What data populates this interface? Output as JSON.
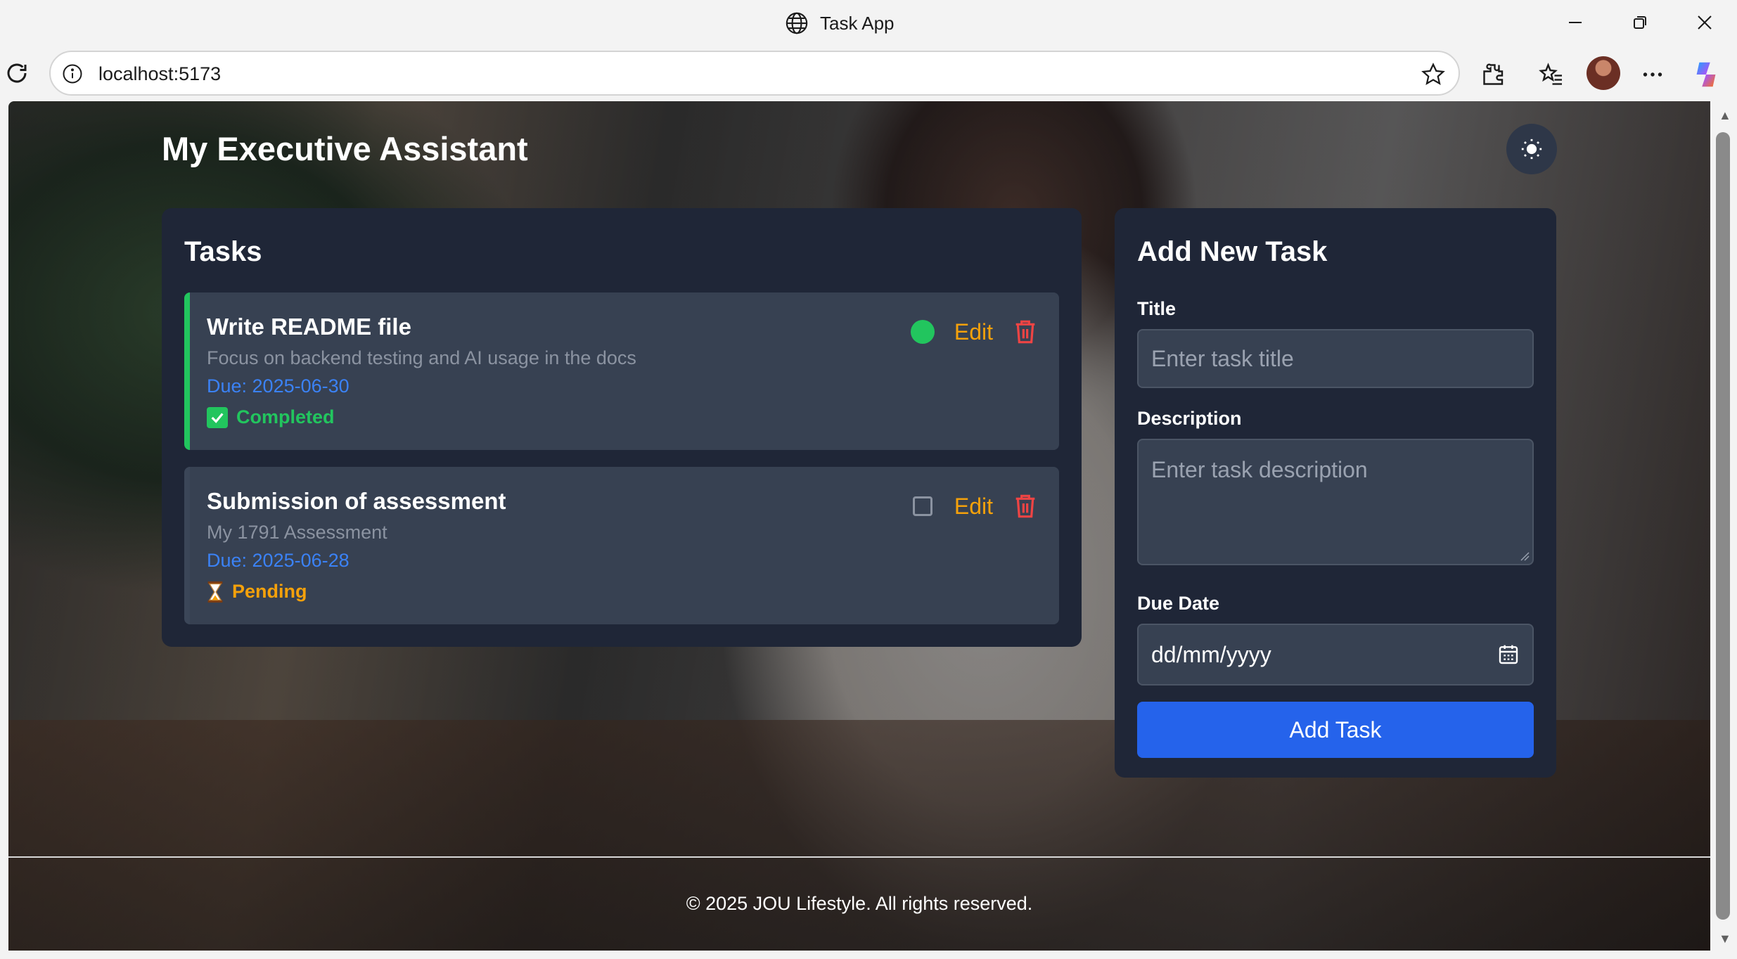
{
  "window": {
    "title": "Task App"
  },
  "browser": {
    "url": "localhost:5173"
  },
  "app": {
    "title": "My Executive Assistant"
  },
  "tasks_panel": {
    "heading": "Tasks",
    "tasks": [
      {
        "title": "Write README file",
        "description": "Focus on backend testing and AI usage in the docs",
        "due": "Due: 2025-06-30",
        "status": "Completed",
        "edit_label": "Edit",
        "completed": true
      },
      {
        "title": "Submission of assessment",
        "description": "My 1791 Assessment",
        "due": "Due: 2025-06-28",
        "status": "Pending",
        "edit_label": "Edit",
        "completed": false
      }
    ]
  },
  "add_panel": {
    "heading": "Add New Task",
    "title_label": "Title",
    "title_placeholder": "Enter task title",
    "description_label": "Description",
    "description_placeholder": "Enter task description",
    "due_label": "Due Date",
    "due_placeholder": "dd/mm/yyyy",
    "submit_label": "Add Task"
  },
  "footer": {
    "text": "© 2025 JOU Lifestyle. All rights reserved."
  },
  "icons": {
    "status_pending": "hourglass-icon",
    "status_completed": "check-box-icon",
    "theme": "sun-icon"
  },
  "colors": {
    "accent": "#2563eb",
    "completed": "#22c55e",
    "pending": "#f5a10b",
    "danger": "#ef4444",
    "panel": "#1f2637"
  }
}
